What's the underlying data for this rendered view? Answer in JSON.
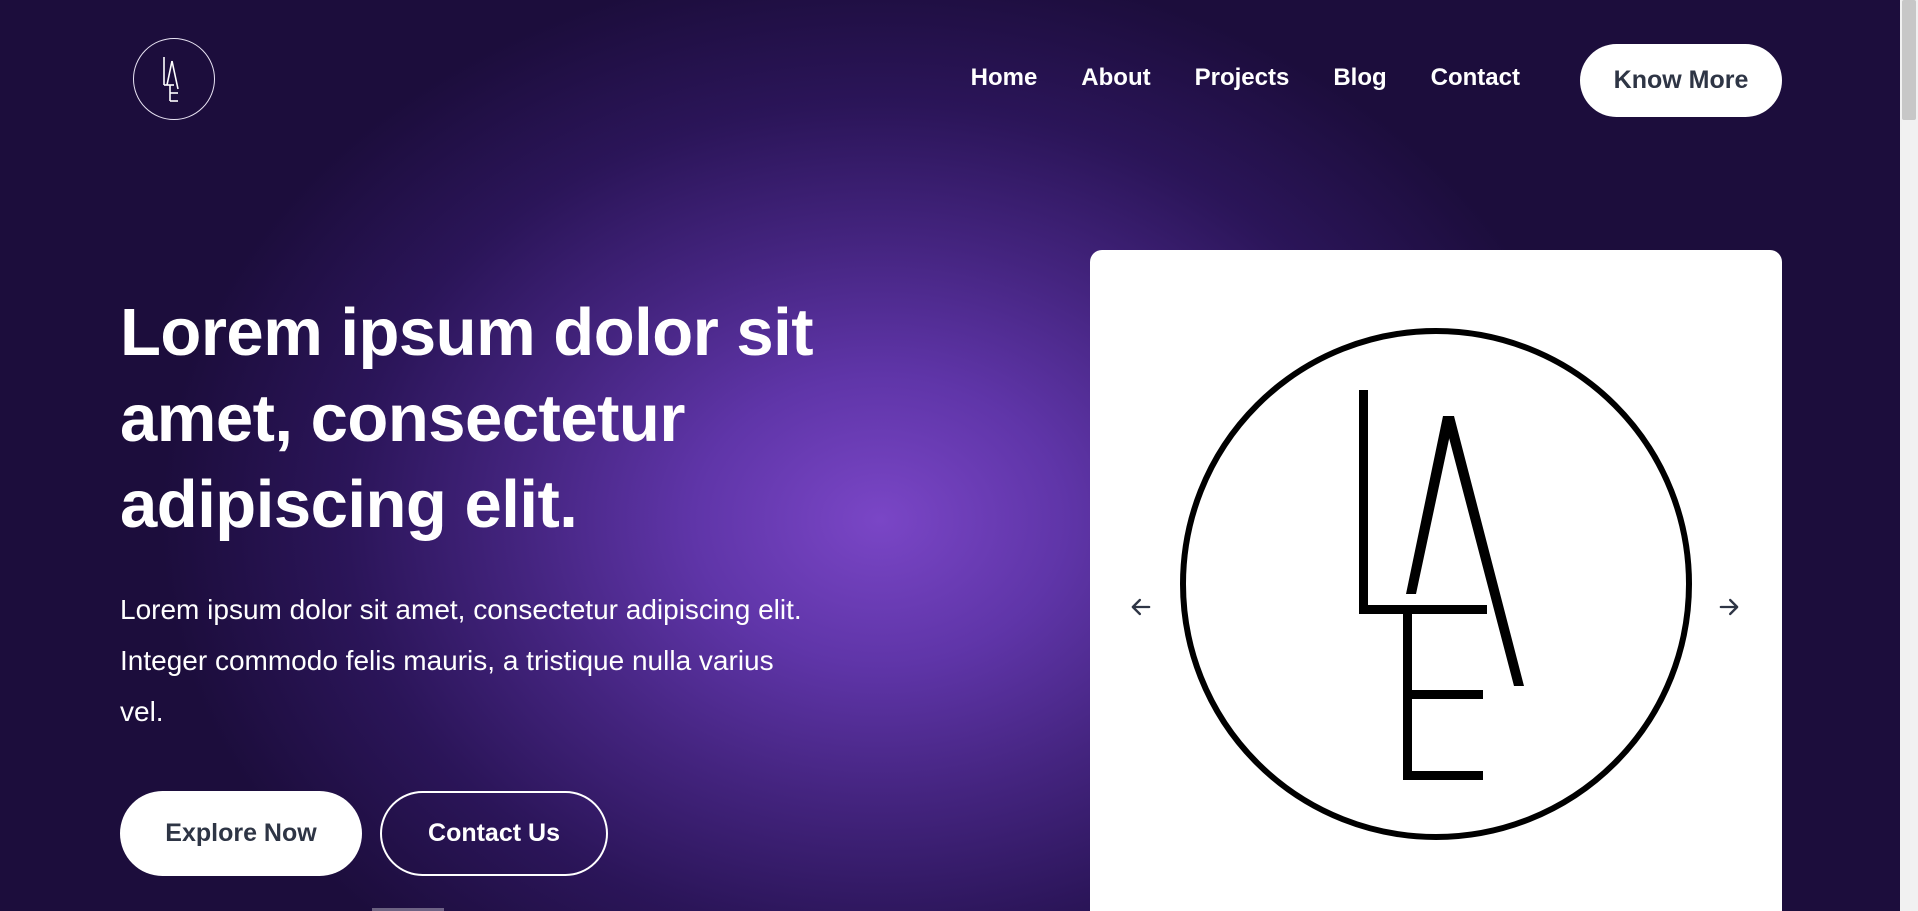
{
  "header": {
    "logo": {
      "text": "LAE",
      "icon": "lae-monogram-logo"
    },
    "nav": [
      {
        "label": "Home"
      },
      {
        "label": "About"
      },
      {
        "label": "Projects"
      },
      {
        "label": "Blog"
      },
      {
        "label": "Contact"
      }
    ],
    "cta_label": "Know More"
  },
  "hero": {
    "title": "Lorem ipsum dolor sit amet, consectetur adipiscing elit.",
    "description": "Lorem ipsum dolor sit amet, consectetur adipiscing elit. Integer commodo felis mauris, a tristique nulla varius vel.",
    "primary_button": "Explore Now",
    "secondary_button": "Contact Us"
  },
  "carousel": {
    "slide_logo": "LAE",
    "prev_icon": "arrow-left-icon",
    "next_icon": "arrow-right-icon"
  },
  "colors": {
    "background_center": "#7a46c6",
    "background_edge": "#1c0d3c",
    "button_bg": "#ffffff",
    "button_text": "#2e3545"
  }
}
